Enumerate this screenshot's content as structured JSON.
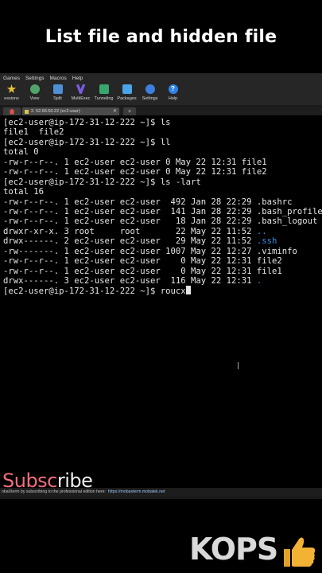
{
  "headline": "List file and hidden file",
  "menu": [
    "Games",
    "Settings",
    "Macros",
    "Help"
  ],
  "toolbar": [
    {
      "label": "essions",
      "icon": "star-icon",
      "color": "#e9c23a"
    },
    {
      "label": "View",
      "icon": "view-icon",
      "color": "#52a36a"
    },
    {
      "label": "Split",
      "icon": "split-icon",
      "color": "#4e8fd6"
    },
    {
      "label": "MultiExec",
      "icon": "multiexec-icon",
      "color": "#7b5be0"
    },
    {
      "label": "Tunneling",
      "icon": "tunneling-icon",
      "color": "#3aa66f"
    },
    {
      "label": "Packages",
      "icon": "packages-icon",
      "color": "#4aa4e8"
    },
    {
      "label": "Settings",
      "icon": "settings-gear-icon",
      "color": "#3c7fe0"
    },
    {
      "label": "Help",
      "icon": "help-icon",
      "color": "#2d83e8"
    }
  ],
  "tabs": {
    "session_label": "2. 52.66.50.22 (ec2-user)",
    "add": "+"
  },
  "terminal": {
    "lines": [
      {
        "text": "[ec2-user@ip-172-31-12-222 ~]$ ls"
      },
      {
        "text": "file1  file2"
      },
      {
        "text": "[ec2-user@ip-172-31-12-222 ~]$ ll"
      },
      {
        "text": "total 0"
      },
      {
        "text": "-rw-r--r--. 1 ec2-user ec2-user 0 May 22 12:31 file1"
      },
      {
        "text": "-rw-r--r--. 1 ec2-user ec2-user 0 May 22 12:31 file2"
      },
      {
        "text": "[ec2-user@ip-172-31-12-222 ~]$ ls -lart"
      },
      {
        "text": "total 16"
      },
      {
        "text": "-rw-r--r--. 1 ec2-user ec2-user  492 Jan 28 22:29 .bashrc"
      },
      {
        "text": "-rw-r--r--. 1 ec2-user ec2-user  141 Jan 28 22:29 .bash_profile"
      },
      {
        "text": "-rw-r--r--. 1 ec2-user ec2-user   18 Jan 28 22:29 .bash_logout"
      },
      {
        "prefix": "drwxr-xr-x. 3 root     root       22 May 22 11:52 ",
        "dirname": ".."
      },
      {
        "prefix": "drwx------. 2 ec2-user ec2-user   29 May 22 11:52 ",
        "dirname": ".ssh"
      },
      {
        "text": "-rw-------. 1 ec2-user ec2-user 1007 May 22 12:27 .viminfo"
      },
      {
        "text": "-rw-r--r--. 1 ec2-user ec2-user    0 May 22 12:31 file2"
      },
      {
        "text": "-rw-r--r--. 1 ec2-user ec2-user    0 May 22 12:31 file1"
      },
      {
        "prefix": "drwx------. 3 ec2-user ec2-user  116 May 22 12:31 ",
        "dirname": "."
      },
      {
        "text": "[ec2-user@ip-172-31-12-222 ~]$ roucx",
        "cursor": true
      }
    ]
  },
  "statusbar": {
    "text": "obaXterm by subscribing to the professional edition here:",
    "link": "https://mobaxterm.mobatek.net"
  },
  "overlay": {
    "subscribe_highlight": "Subsc",
    "subscribe_rest": "ribe",
    "brand": "KOPS",
    "thumb_icon": "thumbs-up-icon"
  }
}
